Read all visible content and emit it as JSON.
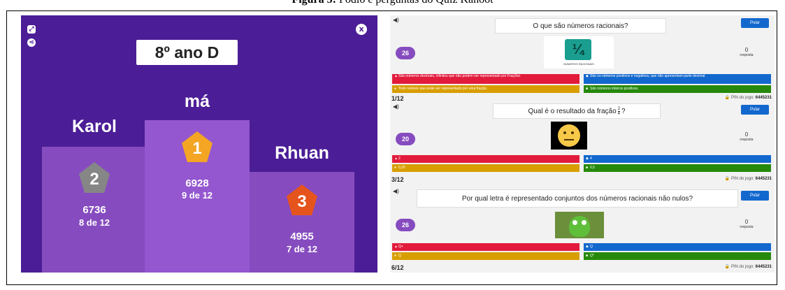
{
  "caption": {
    "bold": "Figura 5:",
    "rest": " Pódio e perguntas do Quiz Kahoot"
  },
  "podium": {
    "title": "8º ano D",
    "close": "x",
    "colors": {
      "background": "#4b1d96",
      "column": "#864cbf",
      "second": "#868686",
      "first": "#f4a523",
      "third": "#e5541d"
    },
    "places": [
      {
        "rank": "1",
        "name": "má",
        "score": "6928",
        "correct": "9 de 12"
      },
      {
        "rank": "2",
        "name": "Karol",
        "score": "6736",
        "correct": "8 de 12"
      },
      {
        "rank": "3",
        "name": "Rhuan",
        "score": "4955",
        "correct": "7 de 12"
      }
    ]
  },
  "quiz": {
    "skip_label": "Pular",
    "pin_label": "PIN do jogo:",
    "pin": "6445231",
    "answers_word": "resposta",
    "panels": [
      {
        "question": "O que são números racionais?",
        "timer": "26",
        "answers_count": "0",
        "image_text": "NÚMEROS RACIONAIS",
        "counter": "1/12",
        "answers": [
          "São números decimais, infinitos que não podem ser representado por Frações.",
          "São os números positivos e negativos, que não apresentam parte decimal.",
          "Todo número que pode ser representado por uma fração.",
          "São números inteiros positivos."
        ]
      },
      {
        "question": "Qual é o resultado da fração",
        "question_suffix": " ?",
        "timer": "20",
        "answers_count": "0",
        "counter": "3/12",
        "answers": [
          "2",
          "4",
          "0,25",
          "0,5"
        ]
      },
      {
        "question": "Por qual letra é representado conjuntos dos números racionais não nulos?",
        "timer": "26",
        "answers_count": "0",
        "counter": "6/12",
        "answers": [
          "Q+",
          "Q",
          "Q",
          "Q*"
        ]
      }
    ]
  }
}
